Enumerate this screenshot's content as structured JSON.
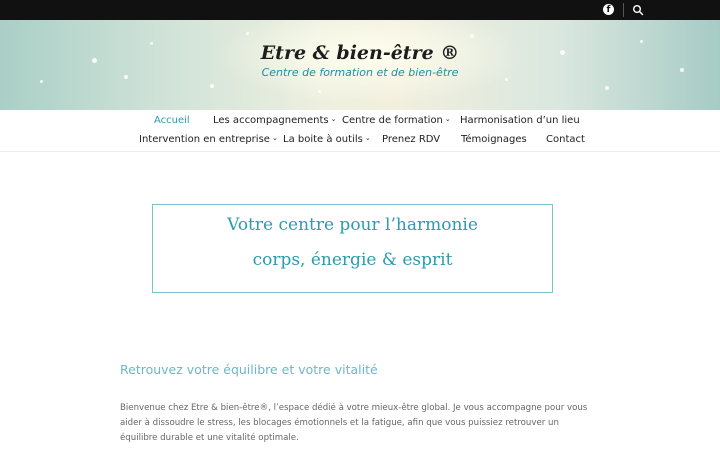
{
  "topbar": {
    "facebook_icon": "facebook-icon",
    "search_icon": "search-icon"
  },
  "header": {
    "site_title": "Etre & bien-être ®",
    "tagline": "Centre de formation et de bien-être"
  },
  "nav": {
    "row1": [
      {
        "label": "Accueil",
        "active": true,
        "has_submenu": false
      },
      {
        "label": "Les accompagnements",
        "active": false,
        "has_submenu": true
      },
      {
        "label": "Centre de formation",
        "active": false,
        "has_submenu": true
      },
      {
        "label": "Harmonisation d’un lieu",
        "active": false,
        "has_submenu": false
      }
    ],
    "row2": [
      {
        "label": "Intervention en entreprise",
        "active": false,
        "has_submenu": true
      },
      {
        "label": "La boite à outils",
        "active": false,
        "has_submenu": true
      },
      {
        "label": "Prenez RDV",
        "active": false,
        "has_submenu": false
      },
      {
        "label": "Témoignages",
        "active": false,
        "has_submenu": false
      },
      {
        "label": "Contact",
        "active": false,
        "has_submenu": false
      }
    ],
    "submenu_glyph": "⌄"
  },
  "hero": {
    "line1": "Votre centre pour l’harmonie",
    "line2": "corps, énergie & esprit"
  },
  "content": {
    "section_title": "Retrouvez votre équilibre et votre vitalité",
    "paragraph": "Bienvenue chez Etre & bien-être®, l’espace dédié à votre mieux-être global. Je vous accompagne pour vous aider à dissoudre le stress, les blocages émotionnels et la fatigue, afin que vous puissiez retrouver un équilibre durable et une vitalité optimale."
  },
  "colors": {
    "accent": "#2b9bb0",
    "topbar": "#111111",
    "hero_border": "#7fc1cc"
  }
}
